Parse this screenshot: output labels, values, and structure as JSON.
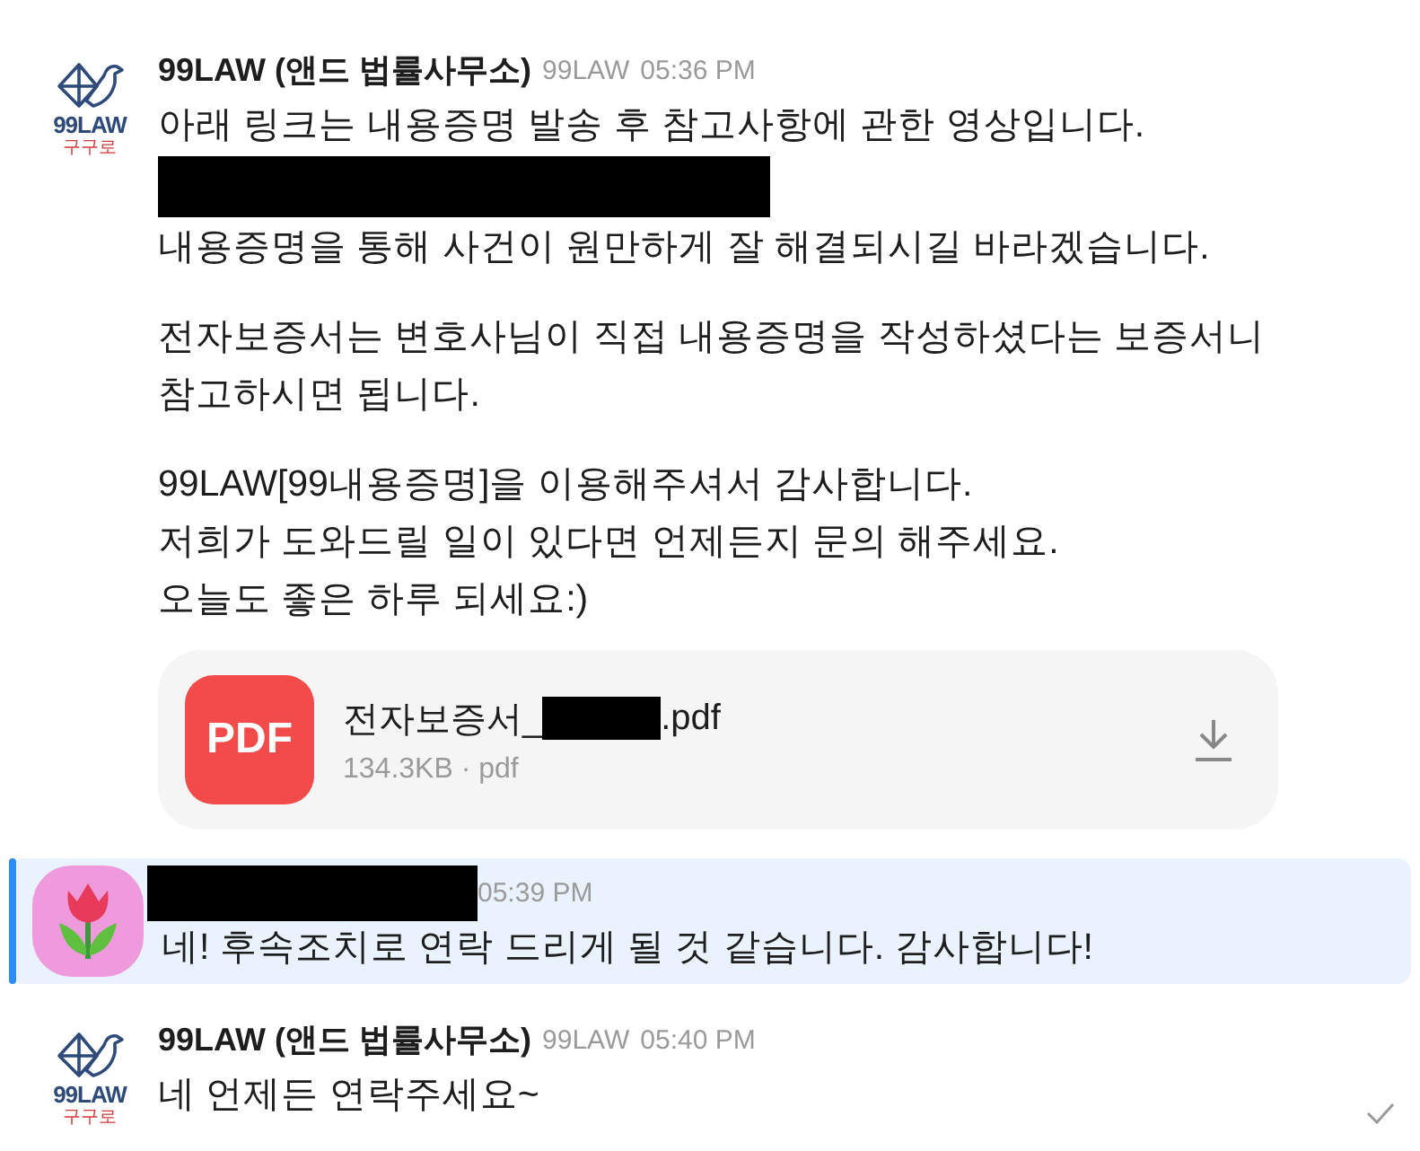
{
  "messages": [
    {
      "avatar": {
        "kind": "logo",
        "wordmark": "99LAW",
        "subtitle": "구구로"
      },
      "kind": "named",
      "sender": "99LAW (앤드 법률사무소)",
      "handle": "99LAW",
      "time": "05:36 PM",
      "highlighted": false,
      "read": false,
      "paragraphs": [
        [
          {
            "kind": "text",
            "text": "아래 링크는 내용증명 발송 후 참고사항에 관한 영상입니다."
          },
          {
            "kind": "redacted"
          },
          {
            "kind": "text",
            "text": "내용증명을 통해 사건이 원만하게 잘 해결되시길 바라겠습니다."
          }
        ],
        [
          {
            "kind": "text",
            "text": "전자보증서는 변호사님이 직접 내용증명을 작성하셨다는 보증서니"
          },
          {
            "kind": "text",
            "text": "참고하시면 됩니다."
          }
        ],
        [
          {
            "kind": "text",
            "text": "99LAW[99내용증명]을 이용해주셔서 감사합니다."
          },
          {
            "kind": "text",
            "text": "저희가 도와드릴 일이 있다면 언제든지 문의 해주세요."
          },
          {
            "kind": "text",
            "text": "오늘도 좋은 하루 되세요:)"
          }
        ]
      ],
      "file": {
        "badge": "PDF",
        "name_start": "전자보증서_",
        "name_end": ".pdf",
        "meta": "134.3KB · pdf"
      }
    },
    {
      "avatar": {
        "kind": "tulip"
      },
      "kind": "redacted",
      "time": "05:39 PM",
      "highlighted": true,
      "read": false,
      "paragraphs": [
        [
          {
            "kind": "text",
            "text": "네! 후속조치로 연락 드리게 될 것 같습니다. 감사합니다!"
          }
        ]
      ]
    },
    {
      "avatar": {
        "kind": "logo",
        "wordmark": "99LAW",
        "subtitle": "구구로"
      },
      "kind": "named",
      "sender": "99LAW (앤드 법률사무소)",
      "handle": "99LAW",
      "time": "05:40 PM",
      "highlighted": false,
      "read": true,
      "paragraphs": [
        [
          {
            "kind": "text",
            "text": "네 언제든 연락주세요~"
          }
        ]
      ]
    }
  ]
}
